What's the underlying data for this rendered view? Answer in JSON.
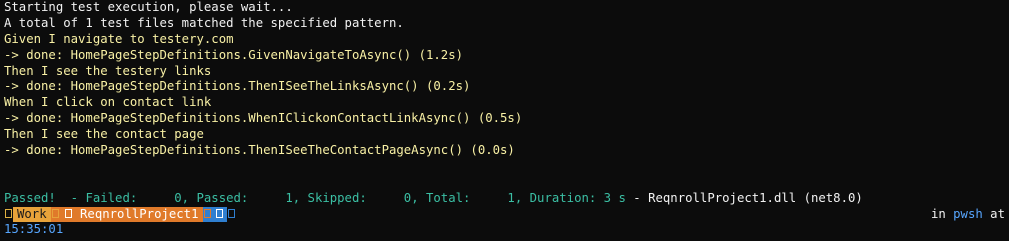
{
  "terminal": {
    "lines": {
      "l1": "Starting test execution, please wait...",
      "l2": "A total of 1 test files matched the specified pattern.",
      "l3": "Given I navigate to testery.com",
      "l4": "-> done: HomePageStepDefinitions.GivenNavigateToAsync() (1.2s)",
      "l5": "Then I see the testery links",
      "l6": "-> done: HomePageStepDefinitions.ThenISeeTheLinksAsync() (0.2s)",
      "l7": "When I click on contact link",
      "l8": "-> done: HomePageStepDefinitions.WhenIClickonContactLinkAsync() (0.5s)",
      "l9": "Then I see the contact page",
      "l10": "-> done: HomePageStepDefinitions.ThenISeeTheContactPageAsync() (0.0s)"
    },
    "summary": {
      "status": "Passed!",
      "counts": "  - Failed:     0, Passed:     1, Skipped:     0, Total:     1, Duration: 3 s",
      "assembly": " - ReqnrollProject1.dll (net8.0)"
    },
    "prompt": {
      "work_label": "Work",
      "project_label": "ReqnrollProject1",
      "right_in": "in ",
      "right_shell": "pwsh",
      "right_at": " at",
      "time": "15:35:01"
    },
    "colors": {
      "background": "#0c0c0c",
      "text_white": "#f2f2f2",
      "text_yellow": "#f9f1a5",
      "text_teal": "#3bbfa4",
      "segment_work": "#e8a33a",
      "segment_project": "#e07a2a",
      "segment_git": "#2f7fd0",
      "time": "#57a6ff"
    },
    "icons": {
      "prompt_start": "os-icon",
      "project_prefix": "folder-icon",
      "git_status": "git-branch-icon"
    }
  }
}
